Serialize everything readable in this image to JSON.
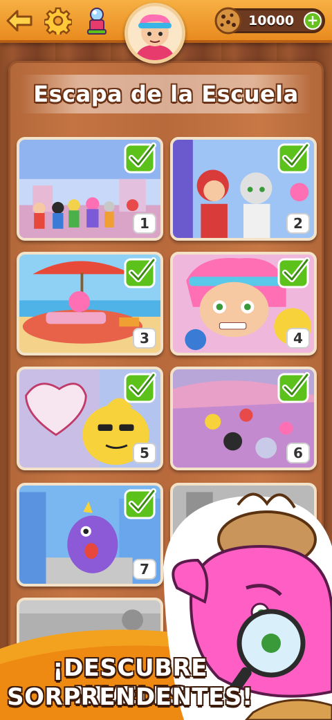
{
  "header": {
    "coins": "10000",
    "icons": [
      "back-arrow-icon",
      "gear-icon",
      "trophy-icon",
      "avatar-portrait",
      "cookie-coin-icon",
      "plus-icon"
    ]
  },
  "banner": {
    "title": "Escapa de la Escuela"
  },
  "levels": [
    {
      "number": "1",
      "completed": true,
      "locked": false
    },
    {
      "number": "2",
      "completed": true,
      "locked": false
    },
    {
      "number": "3",
      "completed": true,
      "locked": false
    },
    {
      "number": "4",
      "completed": true,
      "locked": false
    },
    {
      "number": "5",
      "completed": true,
      "locked": false
    },
    {
      "number": "6",
      "completed": true,
      "locked": false
    },
    {
      "number": "7",
      "completed": true,
      "locked": false
    },
    {
      "number": "",
      "completed": false,
      "locked": true
    },
    {
      "number": "",
      "completed": false,
      "locked": true
    }
  ],
  "promo": {
    "line1": "¡DESCUBRE NIVELES",
    "line2": "SORPRENDENTES!"
  },
  "colors": {
    "topbar": "#f0a032",
    "wood": "#b86a3c",
    "check_green": "#5cc21b",
    "promo_orange": "#f3a21f"
  }
}
